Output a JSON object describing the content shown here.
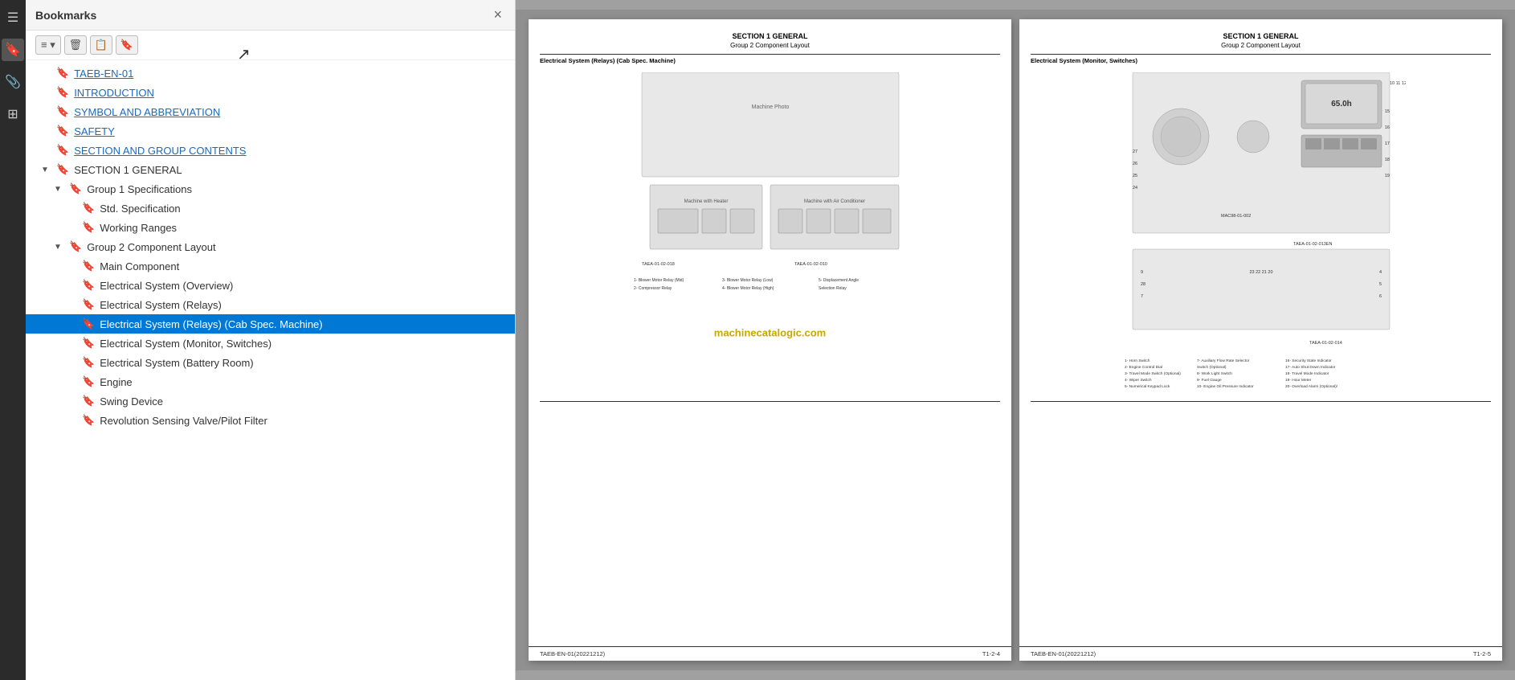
{
  "panel": {
    "title": "Bookmarks",
    "close_label": "×",
    "toolbar_buttons": [
      "≡▾",
      "🗑",
      "📋",
      "🔖"
    ]
  },
  "sidebar_icons": [
    {
      "name": "hamburger-icon",
      "symbol": "☰",
      "active": false
    },
    {
      "name": "bookmark-icon",
      "symbol": "🔖",
      "active": true
    },
    {
      "name": "paperclip-icon",
      "symbol": "📎",
      "active": false
    },
    {
      "name": "layers-icon",
      "symbol": "⊞",
      "active": false
    }
  ],
  "bookmarks": [
    {
      "id": "taeb",
      "label": "TAEB-EN-01",
      "indent": 0,
      "expandable": false,
      "link": true,
      "selected": false
    },
    {
      "id": "intro",
      "label": "INTRODUCTION",
      "indent": 0,
      "expandable": false,
      "link": true,
      "selected": false
    },
    {
      "id": "symbol",
      "label": "SYMBOL AND ABBREVIATION",
      "indent": 0,
      "expandable": false,
      "link": true,
      "selected": false
    },
    {
      "id": "safety",
      "label": "SAFETY",
      "indent": 0,
      "expandable": false,
      "link": true,
      "selected": false
    },
    {
      "id": "section-contents",
      "label": "SECTION AND GROUP CONTENTS",
      "indent": 0,
      "expandable": false,
      "link": true,
      "selected": false
    },
    {
      "id": "section1",
      "label": "SECTION 1 GENERAL",
      "indent": 0,
      "expandable": true,
      "expanded": true,
      "link": false,
      "selected": false
    },
    {
      "id": "group1",
      "label": "Group 1 Specifications",
      "indent": 1,
      "expandable": true,
      "expanded": true,
      "link": false,
      "selected": false
    },
    {
      "id": "std-spec",
      "label": "Std. Specification",
      "indent": 2,
      "expandable": false,
      "link": false,
      "selected": false
    },
    {
      "id": "working-ranges",
      "label": "Working Ranges",
      "indent": 2,
      "expandable": false,
      "link": false,
      "selected": false
    },
    {
      "id": "group2",
      "label": "Group 2 Component Layout",
      "indent": 1,
      "expandable": true,
      "expanded": true,
      "link": false,
      "selected": false
    },
    {
      "id": "main-component",
      "label": "Main Component",
      "indent": 2,
      "expandable": false,
      "link": false,
      "selected": false
    },
    {
      "id": "elec-overview",
      "label": "Electrical System (Overview)",
      "indent": 2,
      "expandable": false,
      "link": false,
      "selected": false
    },
    {
      "id": "elec-relays",
      "label": "Electrical System (Relays)",
      "indent": 2,
      "expandable": false,
      "link": false,
      "selected": false
    },
    {
      "id": "elec-relays-cab",
      "label": "Electrical System (Relays) (Cab Spec. Machine)",
      "indent": 2,
      "expandable": false,
      "link": false,
      "selected": true
    },
    {
      "id": "elec-monitor",
      "label": "Electrical System (Monitor, Switches)",
      "indent": 2,
      "expandable": false,
      "link": false,
      "selected": false
    },
    {
      "id": "elec-battery",
      "label": "Electrical System (Battery Room)",
      "indent": 2,
      "expandable": false,
      "link": false,
      "selected": false
    },
    {
      "id": "engine",
      "label": "Engine",
      "indent": 2,
      "expandable": false,
      "link": false,
      "selected": false
    },
    {
      "id": "swing",
      "label": "Swing Device",
      "indent": 2,
      "expandable": false,
      "link": false,
      "selected": false
    },
    {
      "id": "revolution",
      "label": "Revolution Sensing Valve/Pilot Filter",
      "indent": 2,
      "expandable": false,
      "link": false,
      "selected": false
    }
  ],
  "page_left": {
    "header_title": "SECTION 1 GENERAL",
    "header_subtitle": "Group 2 Component Layout",
    "section_label": "Electrical System (Relays) (Cab Spec. Machine)",
    "footer_left": "TAEB-EN-01(20221212)",
    "footer_right": "T1-2-4"
  },
  "page_right": {
    "header_title": "SECTION 1 GENERAL",
    "header_subtitle": "Group 2 Component Layout",
    "section_label": "Electrical System (Monitor, Switches)",
    "footer_left": "TAEB-EN-01(20221212)",
    "footer_right": "T1-2-5"
  },
  "watermark": "machinecatalogic.com"
}
